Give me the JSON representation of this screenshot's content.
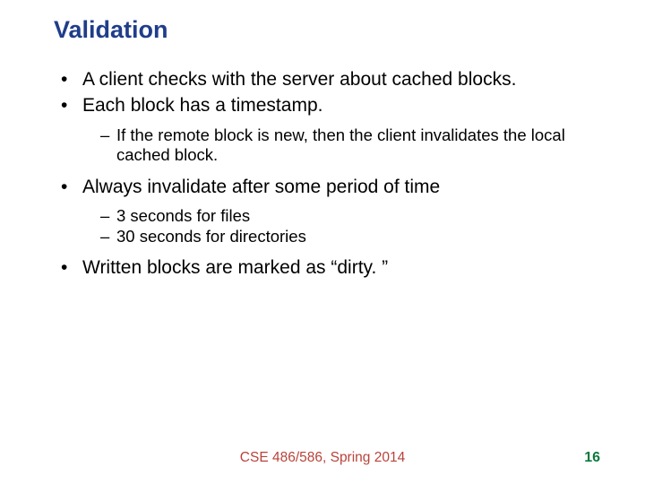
{
  "title": "Validation",
  "bullets": {
    "b1": "A client checks with the server about cached blocks.",
    "b2": "Each block has a timestamp.",
    "b2_1": "If the remote block is new, then the client invalidates the local cached block.",
    "b3": "Always invalidate after some period of time",
    "b3_1": "3 seconds for files",
    "b3_2": "30 seconds for directories",
    "b4": "Written blocks are marked as “dirty. ”"
  },
  "footer": {
    "center": "CSE 486/586, Spring 2014",
    "page": "16"
  }
}
